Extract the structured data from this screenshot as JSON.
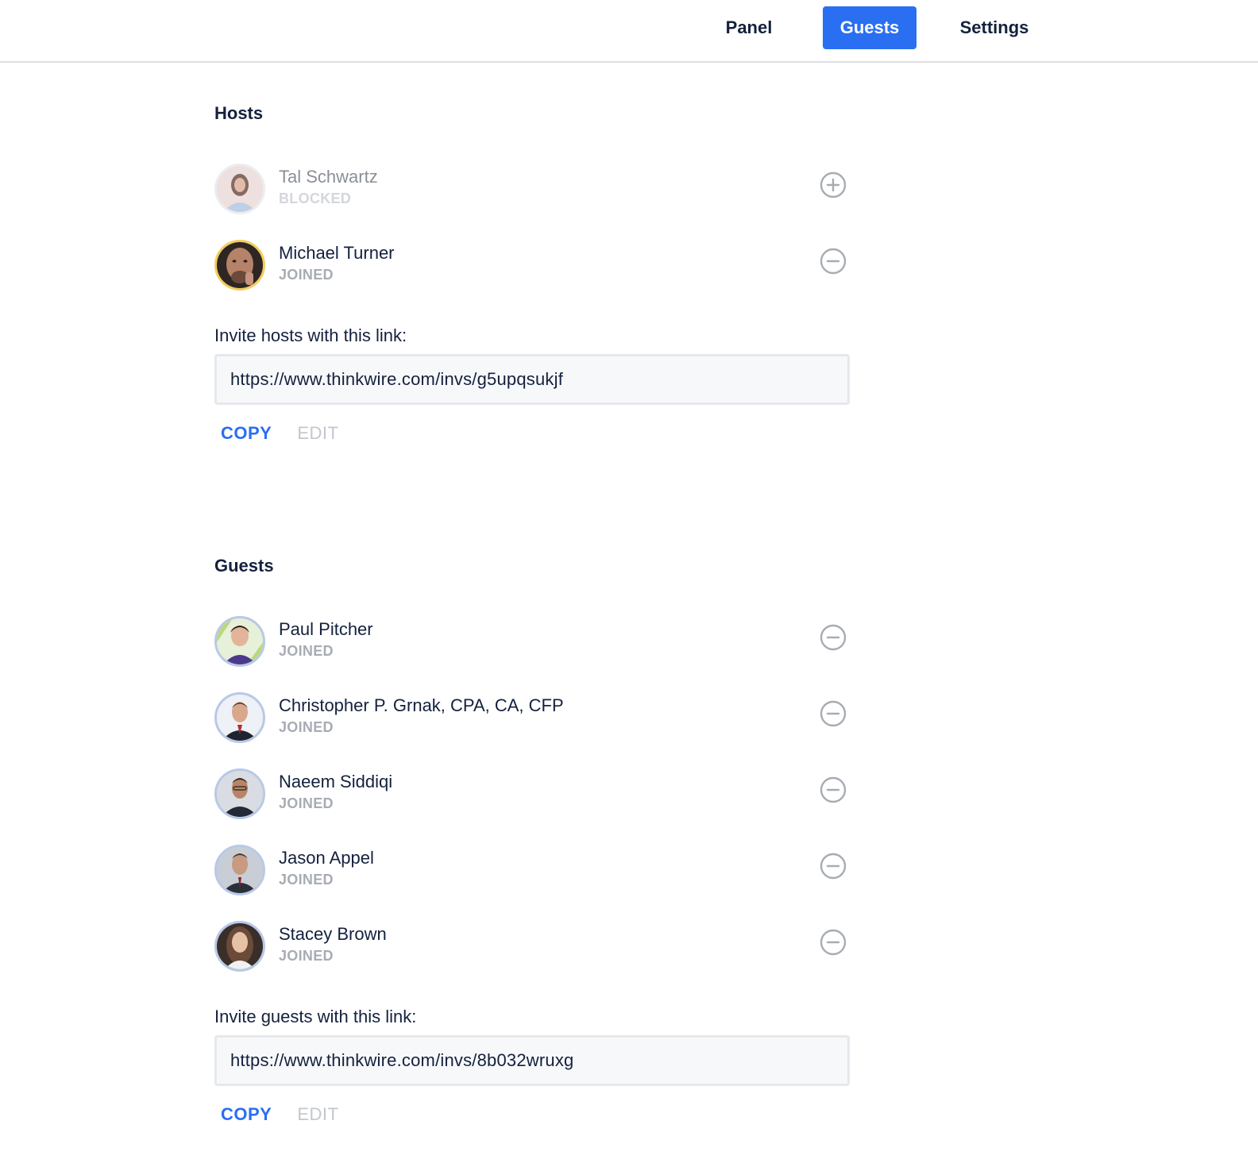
{
  "nav": {
    "tabs": [
      {
        "label": "Panel",
        "active": false
      },
      {
        "label": "Guests",
        "active": true
      },
      {
        "label": "Settings",
        "active": false
      }
    ],
    "accent_color": "#2a6ef2"
  },
  "hosts": {
    "title": "Hosts",
    "people": [
      {
        "name": "Tal Schwartz",
        "status": "BLOCKED",
        "action_icon": "plus-circle-icon"
      },
      {
        "name": "Michael Turner",
        "status": "JOINED",
        "action_icon": "minus-circle-icon"
      }
    ],
    "invite_label": "Invite hosts with this link:",
    "invite_link": "https://www.thinkwire.com/invs/g5upqsukjf",
    "copy_label": "COPY",
    "edit_label": "EDIT"
  },
  "guests": {
    "title": "Guests",
    "people": [
      {
        "name": "Paul Pitcher",
        "status": "JOINED",
        "action_icon": "minus-circle-icon"
      },
      {
        "name": "Christopher P. Grnak, CPA, CA, CFP",
        "status": "JOINED",
        "action_icon": "minus-circle-icon"
      },
      {
        "name": "Naeem Siddiqi",
        "status": "JOINED",
        "action_icon": "minus-circle-icon"
      },
      {
        "name": "Jason Appel",
        "status": "JOINED",
        "action_icon": "minus-circle-icon"
      },
      {
        "name": "Stacey Brown",
        "status": "JOINED",
        "action_icon": "minus-circle-icon"
      }
    ],
    "invite_label": "Invite guests with this link:",
    "invite_link": "https://www.thinkwire.com/invs/8b032wruxg",
    "copy_label": "COPY",
    "edit_label": "EDIT"
  }
}
